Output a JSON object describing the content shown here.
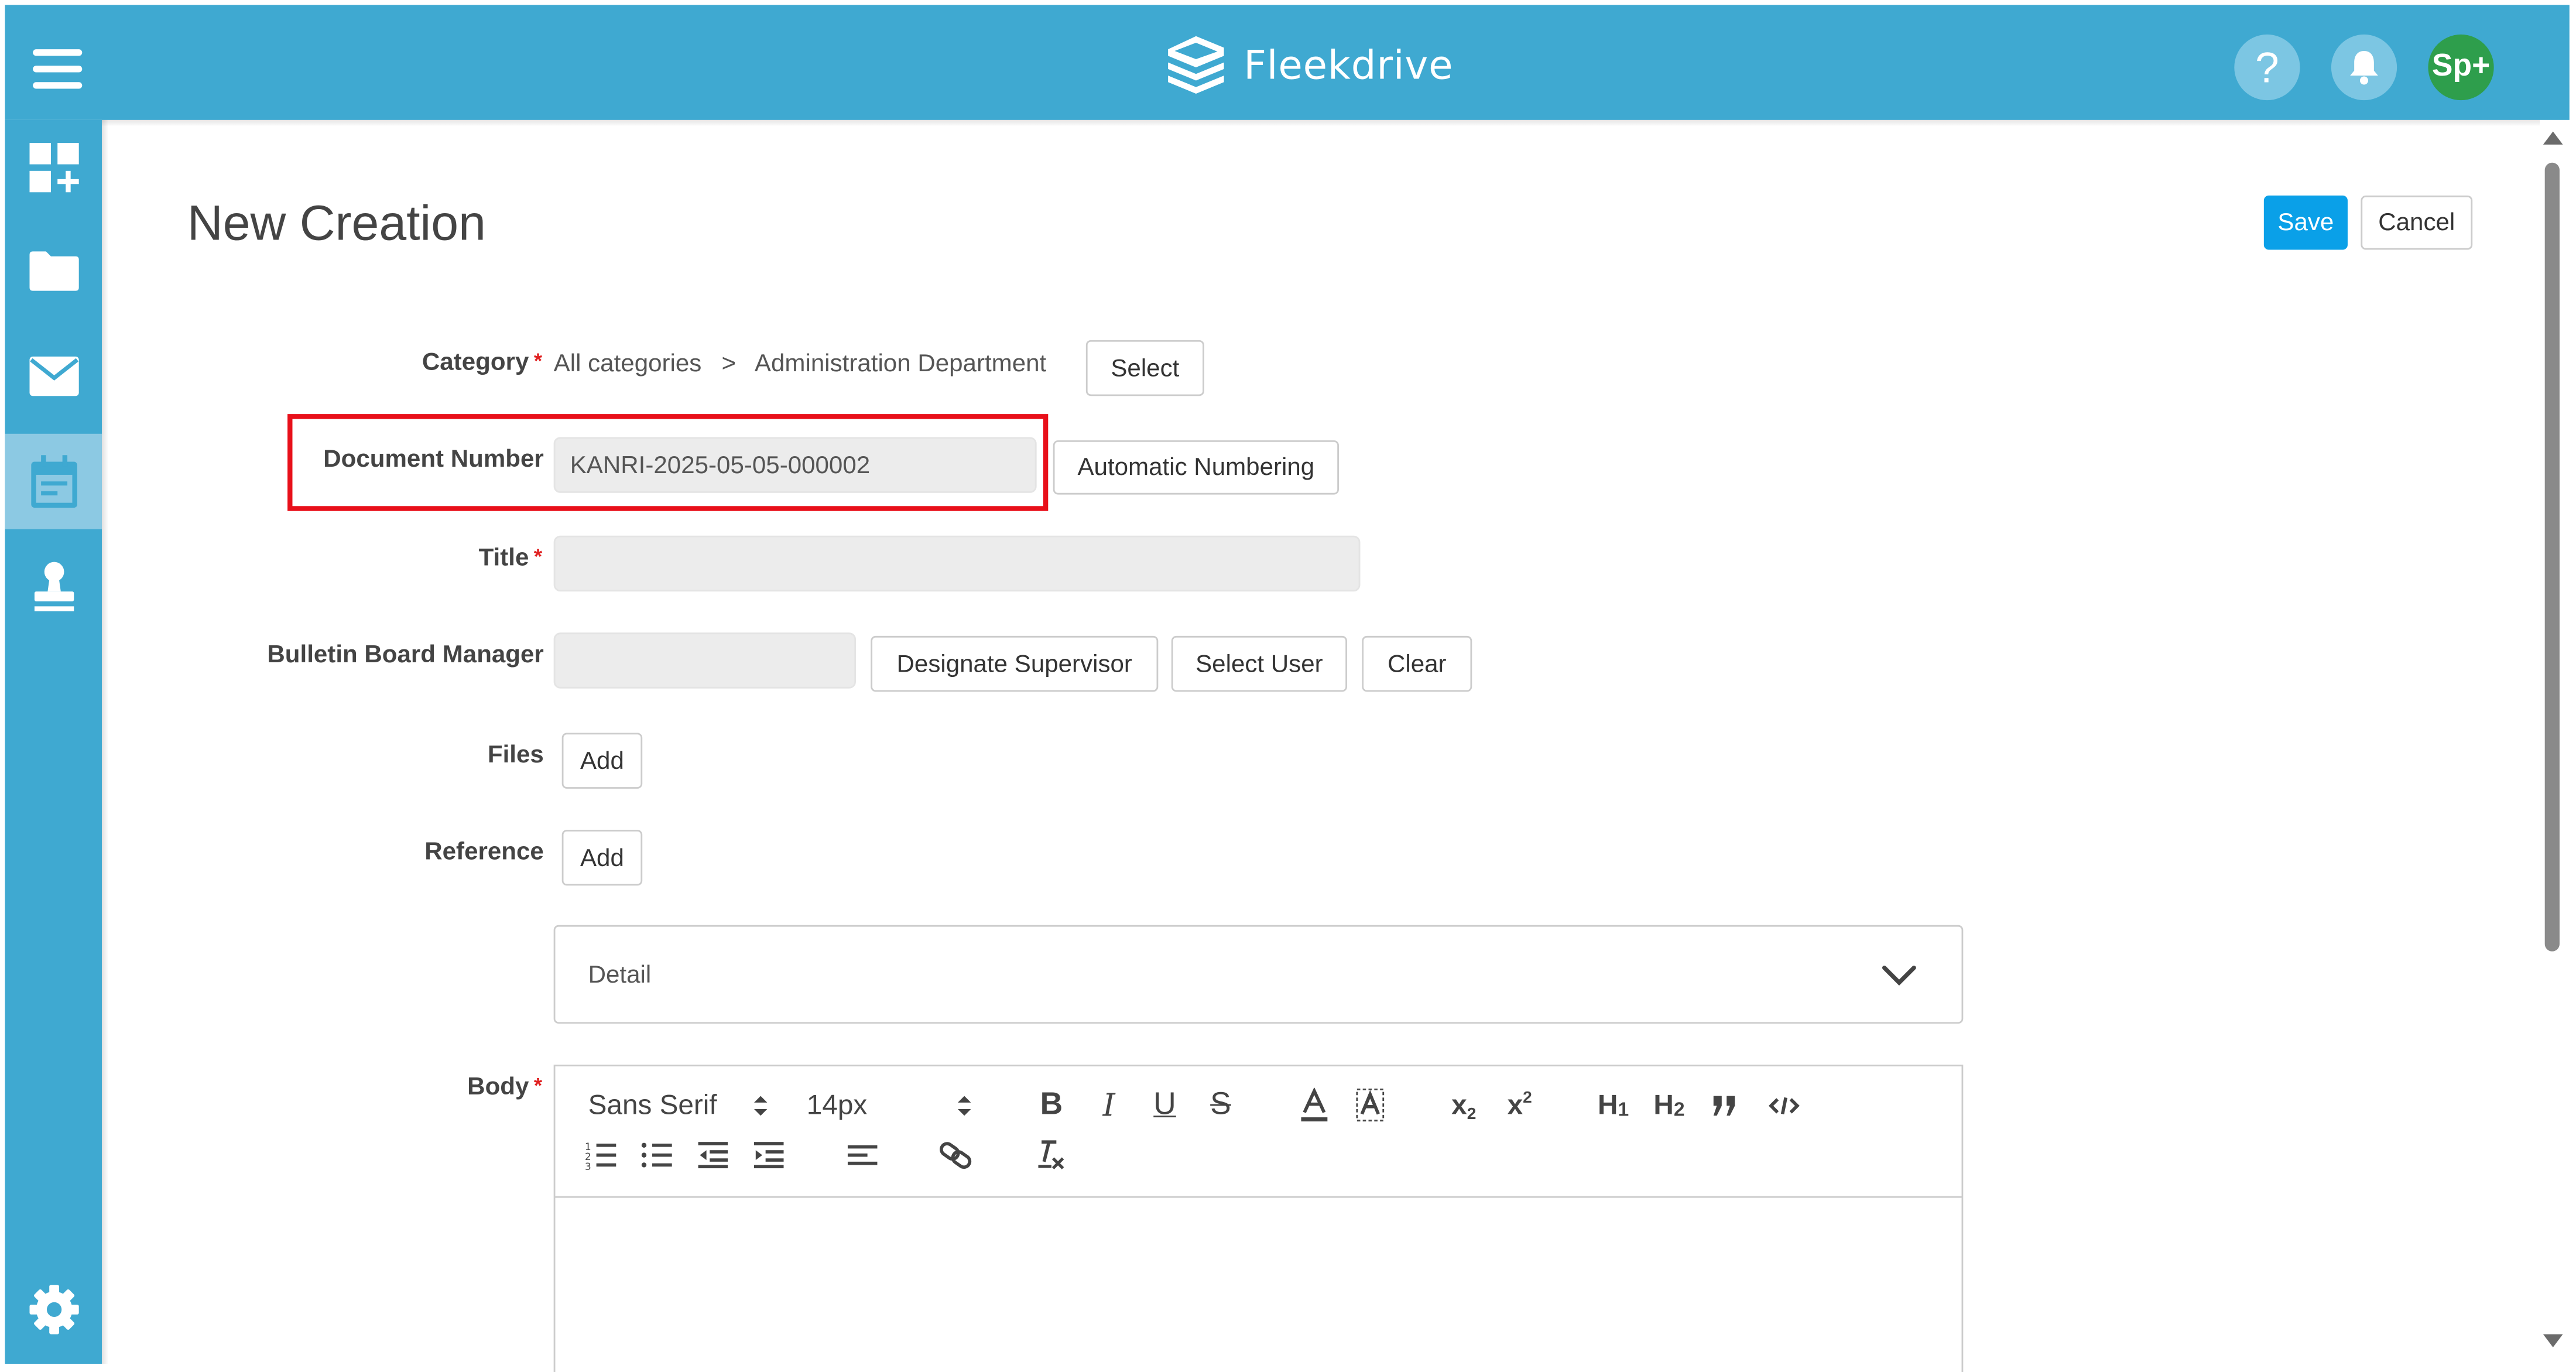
{
  "app": {
    "logo_text": "Fleekdrive",
    "help_label": "?",
    "avatar_label": "Sp+"
  },
  "sidebar": {
    "items": [
      {
        "icon": "dashboard-add-icon"
      },
      {
        "icon": "folder-icon"
      },
      {
        "icon": "mail-icon"
      },
      {
        "icon": "calendar-icon",
        "active": true
      },
      {
        "icon": "stamp-icon"
      }
    ],
    "settings_icon": "gear-icon"
  },
  "page": {
    "title": "New Creation",
    "save_label": "Save",
    "cancel_label": "Cancel"
  },
  "form": {
    "category": {
      "label": "Category",
      "path": [
        "All categories",
        "Administration Department"
      ],
      "separator": ">",
      "select_label": "Select"
    },
    "document_number": {
      "label": "Document Number",
      "value": "KANRI-2025-05-05-000002",
      "auto_label": "Automatic Numbering"
    },
    "title": {
      "label": "Title",
      "value": ""
    },
    "bulletin_manager": {
      "label": "Bulletin Board Manager",
      "value": "",
      "designate_label": "Designate Supervisor",
      "select_user_label": "Select User",
      "clear_label": "Clear"
    },
    "files": {
      "label": "Files",
      "add_label": "Add"
    },
    "reference": {
      "label": "Reference",
      "add_label": "Add"
    },
    "detail": {
      "label": "Detail"
    },
    "body": {
      "label": "Body",
      "font_family": "Sans Serif",
      "font_size": "14px"
    }
  },
  "colors": {
    "header": "#3fa9d1",
    "sidebar_active": "#8cc9e3",
    "save_button": "#0aa0e8",
    "avatar": "#2e9e4c",
    "highlight": "#e8101a",
    "required": "#e02020"
  }
}
